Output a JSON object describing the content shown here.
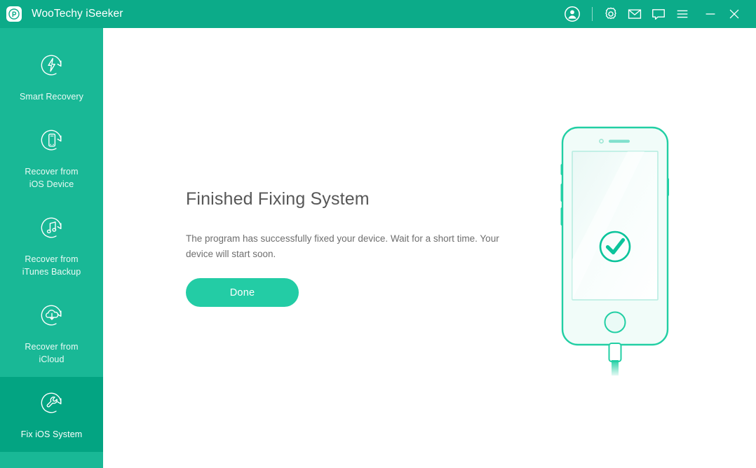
{
  "window": {
    "app_title": "WooTechy iSeeker",
    "logo_icon": "wootechy-logo-icon",
    "accent_color": "#0cab89",
    "titlebar_buttons": [
      {
        "name": "account-button",
        "icon": "user-account-icon",
        "label": "Account"
      },
      {
        "name": "settings-button",
        "icon": "gear-icon",
        "label": "Settings"
      },
      {
        "name": "mail-button",
        "icon": "envelope-icon",
        "label": "Mail"
      },
      {
        "name": "feedback-button",
        "icon": "speech-bubble-icon",
        "label": "Feedback"
      },
      {
        "name": "menu-button",
        "icon": "hamburger-menu-icon",
        "label": "Menu"
      },
      {
        "name": "minimize-button",
        "icon": "minimize-icon",
        "label": "Minimize"
      },
      {
        "name": "close-button",
        "icon": "close-icon",
        "label": "Close"
      }
    ]
  },
  "sidebar": {
    "background_color": "#19b896",
    "active_color": "#03a482",
    "items": [
      {
        "id": "smart-recovery",
        "label": "Smart Recovery",
        "icon": "bolt-refresh-icon",
        "active": false
      },
      {
        "id": "recover-from-ios-device",
        "label": "Recover from\niOS Device",
        "icon": "phone-refresh-icon",
        "active": false
      },
      {
        "id": "recover-from-itunes-backup",
        "label": "Recover from\niTunes Backup",
        "icon": "music-note-refresh-icon",
        "active": false
      },
      {
        "id": "recover-from-icloud",
        "label": "Recover from\niCloud",
        "icon": "cloud-download-refresh-icon",
        "active": false
      },
      {
        "id": "fix-ios-system",
        "label": "Fix iOS System",
        "icon": "wrench-refresh-icon",
        "active": true
      }
    ]
  },
  "main": {
    "heading": "Finished Fixing System",
    "description": "The program has successfully fixed your device. Wait for a short time. Your device will start soon.",
    "done_button_label": "Done",
    "done_button_color": "#23ccA5",
    "heading_color": "#575757",
    "description_color": "#6e6e6e",
    "illustration": {
      "name": "iphone-with-checkmark-illustration",
      "device_icon": "smartphone-icon",
      "status_icon": "check-circle-icon",
      "cable_icon": "lightning-cable-icon",
      "outline_color": "#22cfa4",
      "screen_color": "#f4fcfa"
    }
  }
}
